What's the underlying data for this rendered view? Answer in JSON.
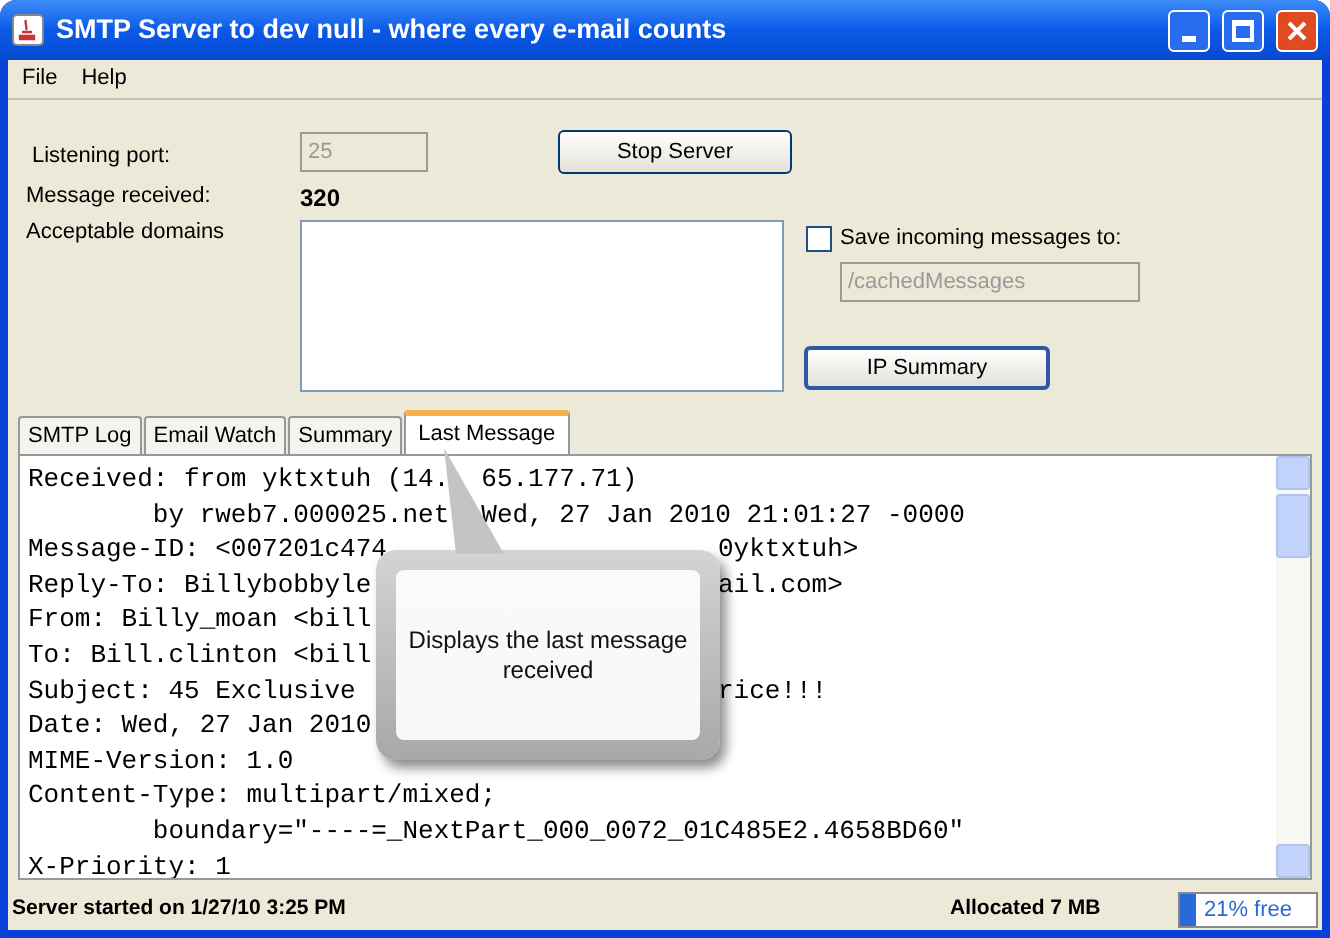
{
  "window": {
    "title": "SMTP Server to dev null - where every e-mail counts"
  },
  "menu": [
    "File",
    "Help"
  ],
  "settings": {
    "port_label": "Listening port:",
    "port_value": "25",
    "received_label": "Message received:",
    "received_value": "320",
    "domains_label": "Acceptable domains",
    "stop_button": "Stop Server",
    "save_checkbox": {
      "label": "Save incoming messages to:",
      "checked": false
    },
    "save_path": "/cachedMessages",
    "ip_button": "IP Summary"
  },
  "tabs": [
    {
      "label": "SMTP Log",
      "selected": false
    },
    {
      "label": "Email Watch",
      "selected": false
    },
    {
      "label": "Summary",
      "selected": false
    },
    {
      "label": "Last Message",
      "selected": true
    }
  ],
  "message_lines": [
    {
      "segments": [
        {
          "kind": "left",
          "text": "Received: from yktxtuh (14."
        },
        {
          "kind": "after_pointer",
          "text": "65.177.71)"
        }
      ]
    },
    {
      "segments": [
        {
          "kind": "left",
          "text": "        by rweb7.000025.net"
        },
        {
          "kind": "after_pointer",
          "text": "Wed, 27 Jan 2010 21:01:27 -0000"
        }
      ]
    },
    {
      "segments": [
        {
          "kind": "left",
          "text": "Message-ID: <007201c474"
        },
        {
          "kind": "after_callout",
          "text": "0yktxtuh>"
        }
      ]
    },
    {
      "segments": [
        {
          "kind": "left",
          "text": "Reply-To: Billybobbyle"
        },
        {
          "kind": "after_callout",
          "text": "ail.com>"
        }
      ]
    },
    {
      "segments": [
        {
          "kind": "left",
          "text": "From: Billy_moan <bill"
        }
      ]
    },
    {
      "segments": [
        {
          "kind": "left",
          "text": "To: Bill.clinton <bill"
        }
      ]
    },
    {
      "segments": [
        {
          "kind": "left",
          "text": "Subject: 45 Exclusive"
        },
        {
          "kind": "after_callout",
          "text": "rice!!!"
        }
      ]
    },
    {
      "segments": [
        {
          "kind": "left",
          "text": "Date: Wed, 27 Jan 2010"
        }
      ]
    },
    {
      "segments": [
        {
          "kind": "left",
          "text": "MIME-Version: 1.0"
        }
      ]
    },
    {
      "segments": [
        {
          "kind": "left",
          "text": "Content-Type: multipart/mixed;"
        }
      ]
    },
    {
      "segments": [
        {
          "kind": "left",
          "text": "        boundary=\"----=_NextPart_000_0072_01C485E2.4658BD60\""
        }
      ]
    },
    {
      "segments": [
        {
          "kind": "left",
          "text": "X-Priority: 1"
        }
      ]
    }
  ],
  "callout": {
    "text": "Displays the last message received"
  },
  "status_bar": {
    "started": "Server started on 1/27/10 3:25 PM",
    "allocated": "Allocated 7 MB",
    "memory": {
      "text": "21% free",
      "level": 0.12
    }
  }
}
